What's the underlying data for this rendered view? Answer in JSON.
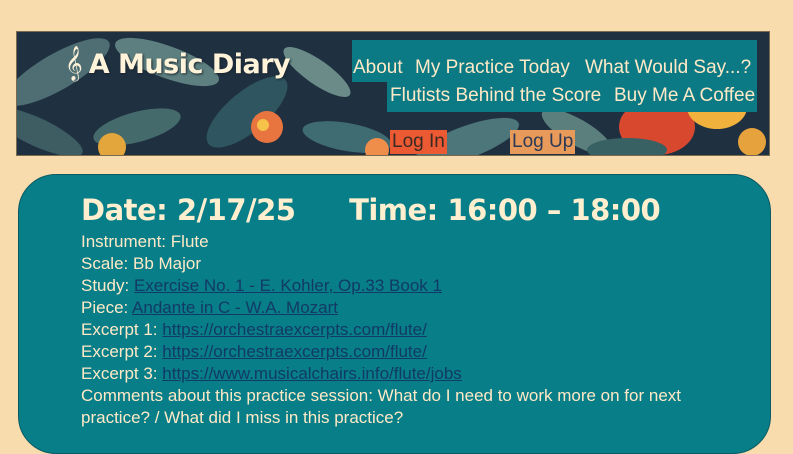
{
  "header": {
    "logo_glyph": "𝄞",
    "title": "A Music Diary",
    "nav": [
      "About",
      "My Practice Today",
      "What Would Say...?",
      "Flutists Behind the Score",
      "Buy Me A Coffee"
    ],
    "login_label": "Log In",
    "logup_label": "Log Up"
  },
  "session": {
    "date_label": "Date:",
    "date": "2/17/25",
    "time_label": "Time:",
    "time": "16:00 – 18:00",
    "instrument_label": "Instrument:",
    "instrument": "Flute",
    "scale_label": "Scale:",
    "scale": "Bb Major",
    "study_label": "Study:",
    "study": "Exercise No. 1 - E. Kohler, Op.33 Book 1",
    "piece_label": "Piece:",
    "piece": "Andante in C - W.A. Mozart",
    "excerpt1_label": "Excerpt 1:",
    "excerpt1": "https://orchestraexcerpts.com/flute/",
    "excerpt2_label": "Excerpt 2:",
    "excerpt2": "https://orchestraexcerpts.com/flute/",
    "excerpt3_label": "Excerpt 3:",
    "excerpt3": "https://www.musicalchairs.info/flute/jobs",
    "comments": "Comments about this practice session:  What do I need to work more on for next practice? / What did I miss in this practice?"
  },
  "colors": {
    "page_bg": "#f8dcae",
    "teal": "#077e88",
    "cream_text": "#ffe9c6",
    "link": "#123a66",
    "login_bg": "#ec5a33",
    "logup_bg": "#e79a5a"
  }
}
